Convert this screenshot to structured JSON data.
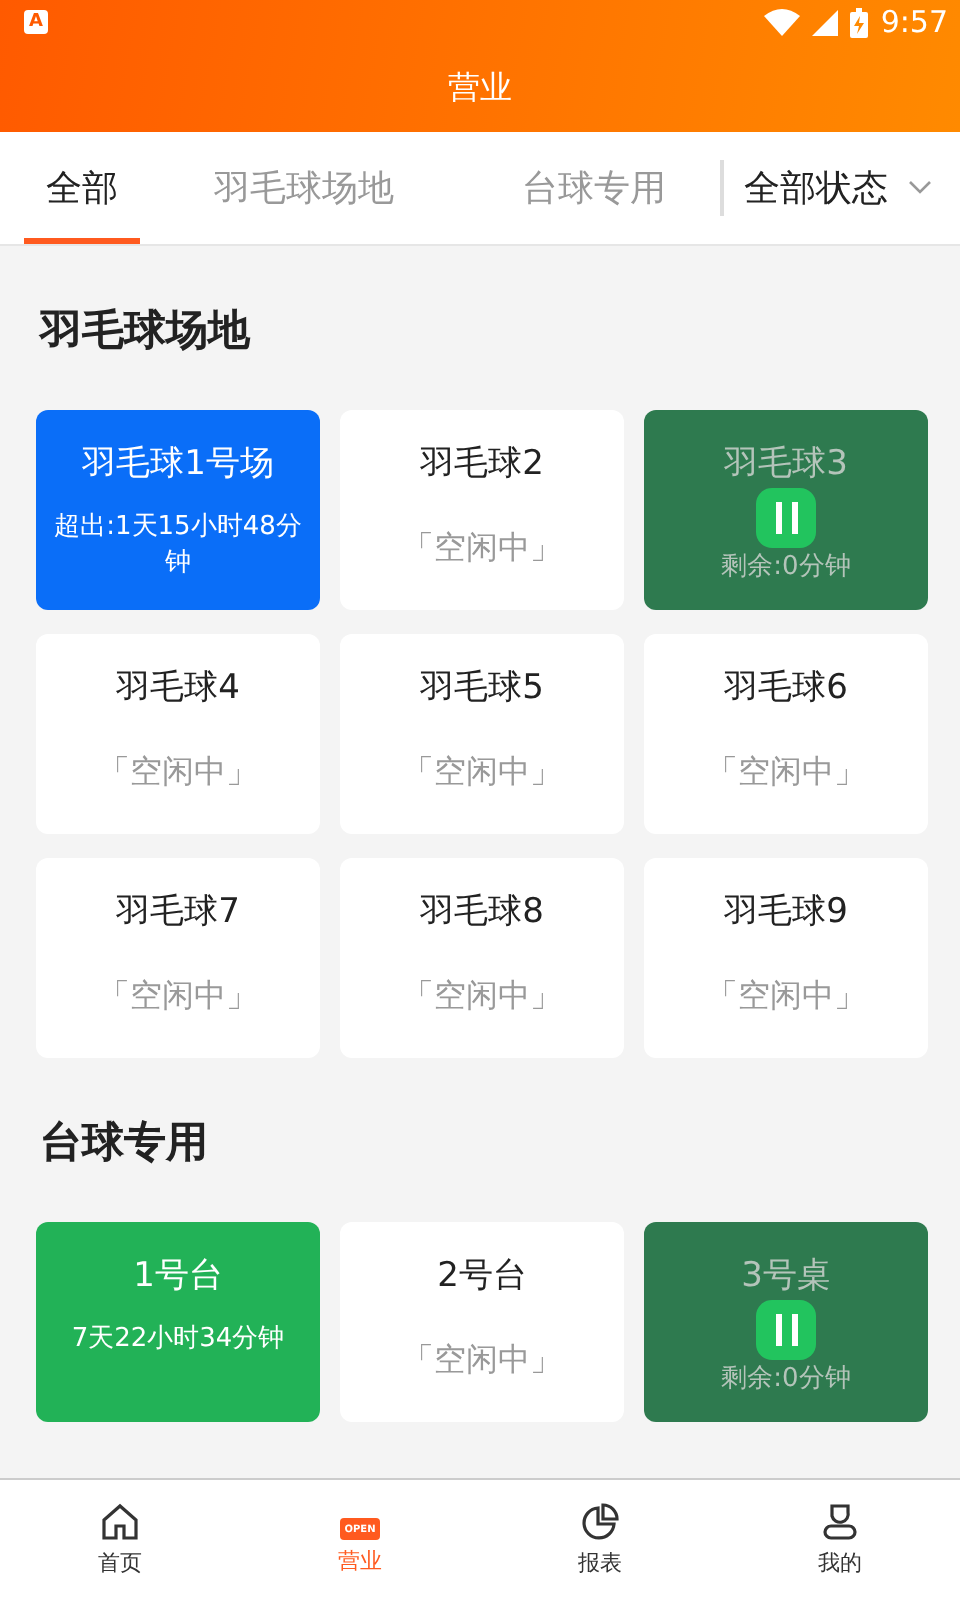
{
  "status_bar": {
    "app_badge": "A",
    "time": "9:57"
  },
  "header": {
    "title": "营业"
  },
  "tabs": [
    {
      "label": "全部",
      "selected": true
    },
    {
      "label": "羽毛球场地",
      "selected": false
    },
    {
      "label": "台球专用",
      "selected": false
    }
  ],
  "filter": {
    "label": "全部状态"
  },
  "sections": [
    {
      "title": "羽毛球场地",
      "venues": [
        {
          "name": "羽毛球1号场",
          "kind": "overtime",
          "detail": "超出:1天15小时48分钟"
        },
        {
          "name": "羽毛球2",
          "kind": "idle",
          "detail": "「空闲中」"
        },
        {
          "name": "羽毛球3",
          "kind": "paused",
          "detail": "剩余:0分钟"
        },
        {
          "name": "羽毛球4",
          "kind": "idle",
          "detail": "「空闲中」"
        },
        {
          "name": "羽毛球5",
          "kind": "idle",
          "detail": "「空闲中」"
        },
        {
          "name": "羽毛球6",
          "kind": "idle",
          "detail": "「空闲中」"
        },
        {
          "name": "羽毛球7",
          "kind": "idle",
          "detail": "「空闲中」"
        },
        {
          "name": "羽毛球8",
          "kind": "idle",
          "detail": "「空闲中」"
        },
        {
          "name": "羽毛球9",
          "kind": "idle",
          "detail": "「空闲中」"
        }
      ]
    },
    {
      "title": "台球专用",
      "venues": [
        {
          "name": "1号台",
          "kind": "running",
          "detail": "7天22小时34分钟"
        },
        {
          "name": "2号台",
          "kind": "idle",
          "detail": "「空闲中」"
        },
        {
          "name": "3号桌",
          "kind": "paused",
          "detail": "剩余:0分钟"
        }
      ]
    }
  ],
  "nav": [
    {
      "label": "首页",
      "kind": "home",
      "selected": false
    },
    {
      "label": "营业",
      "kind": "open",
      "icon_text": "OPEN",
      "selected": true
    },
    {
      "label": "报表",
      "kind": "chart",
      "selected": false
    },
    {
      "label": "我的",
      "kind": "user",
      "selected": false
    }
  ]
}
